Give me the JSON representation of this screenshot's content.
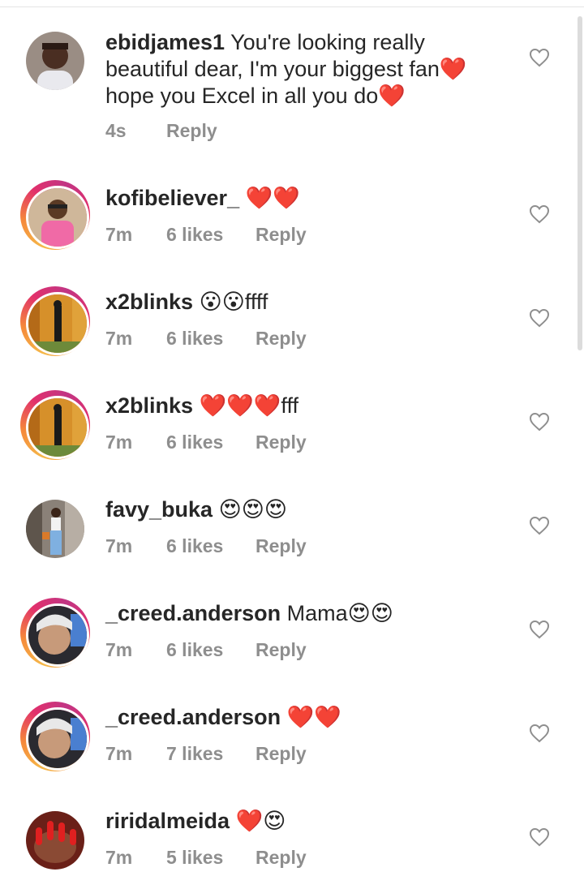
{
  "comments": [
    {
      "username": "ebidjames1",
      "text": "You're looking really beautiful dear, I'm your biggest fan❤️ hope you Excel in all you do❤️",
      "time": "4s",
      "likes": "",
      "reply": "Reply"
    },
    {
      "username": "kofibeliever_",
      "text": "❤️❤️",
      "time": "7m",
      "likes": "6 likes",
      "reply": "Reply"
    },
    {
      "username": "x2blinks",
      "text": "😮😮ffff",
      "time": "7m",
      "likes": "6 likes",
      "reply": "Reply"
    },
    {
      "username": "x2blinks",
      "text": "❤️❤️❤️fff",
      "time": "7m",
      "likes": "6 likes",
      "reply": "Reply"
    },
    {
      "username": "favy_buka",
      "text": "😍😍😍",
      "time": "7m",
      "likes": "6 likes",
      "reply": "Reply"
    },
    {
      "username": "_creed.anderson",
      "text": "Mama😍😍",
      "time": "7m",
      "likes": "6 likes",
      "reply": "Reply"
    },
    {
      "username": "_creed.anderson",
      "text": "❤️❤️",
      "time": "7m",
      "likes": "7 likes",
      "reply": "Reply"
    },
    {
      "username": "riridalmeida",
      "text": "❤️😍",
      "time": "7m",
      "likes": "5 likes",
      "reply": "Reply"
    }
  ]
}
